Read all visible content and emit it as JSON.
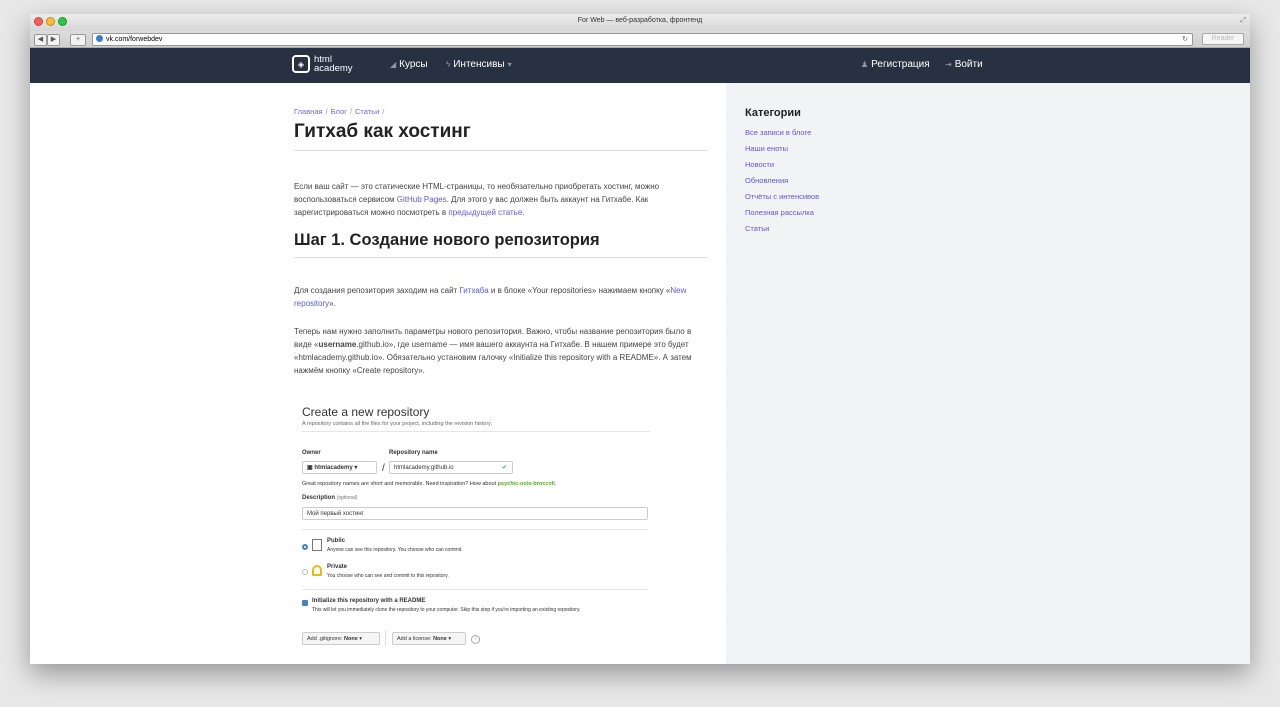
{
  "window": {
    "title": "For Web — веб-разработка, фронтенд",
    "url": "vk.com/forwebdev",
    "reader": "Reader"
  },
  "nav": {
    "logo_line1": "html",
    "logo_line2": "academy",
    "courses": "Курсы",
    "intensives": "Интенсивы",
    "register": "Регистрация",
    "login": "Войти"
  },
  "breadcrumbs": [
    "Главная",
    "Блог",
    "Статьи"
  ],
  "article": {
    "title": "Гитхаб как хостинг",
    "intro": {
      "t1": "Если ваш сайт — это статические HTML-страницы, то необязательно приобретать хостинг, можно воспользоваться сервисом ",
      "link1": "GitHub Pages",
      "t2": ". Для этого у вас должен быть аккаунт на Гитхабе. Как зарегистрироваться можно посмотреть в ",
      "link2": "предыдущей статье",
      "t3": "."
    },
    "step1_title": "Шаг 1. Создание нового репозитория",
    "p2": {
      "t1": "Для создания репозитория заходим на сайт ",
      "link1": "Гитхаба",
      "t2": " и в блоке «Your repositories» нажимаем кнопку «",
      "link2": "New repository",
      "t3": "»."
    },
    "p3": {
      "t1": "Теперь нам нужно заполнить параметры нового репозитория. Важно, чтобы название репозитория было в виде «",
      "bold": "username",
      "t2": ".github.io», где username — имя вашего аккаунта на Гитхабе. В нашем примере это будет «htmlacademy.github.io». Обязательно установим галочку «Initialize this repository with a README». А затем нажмём кнопку «Create repository»."
    }
  },
  "github": {
    "title": "Create a new repository",
    "subtitle": "A repository contains all the files for your project, including the revision history.",
    "owner_label": "Owner",
    "repo_label": "Repository name",
    "owner_value": "htmlacademy",
    "repo_value": "htmlacademy.github.io",
    "hint": "Great repository names are short and memorable. Need inspiration? How about ",
    "hint_name": "psychic-octo-broccoli",
    "desc_label": "Description",
    "desc_optional": "(optional)",
    "desc_value": "Мой первый хостинг",
    "public_label": "Public",
    "public_desc": "Anyone can see this repository. You choose who can commit.",
    "private_label": "Private",
    "private_desc": "You choose who can see and commit to this repository.",
    "readme_label": "Initialize this repository with a README",
    "readme_desc": "This will let you immediately clone the repository to your computer. Skip this step if you're importing an existing repository.",
    "gitignore": "Add .gitignore: ",
    "gitignore_val": "None",
    "license": "Add a license: ",
    "license_val": "None"
  },
  "sidebar": {
    "heading": "Категории",
    "links": [
      "Все записи в блоге",
      "Наши еноты",
      "Новости",
      "Обновления",
      "Отчёты с интенсивов",
      "Полезная рассылка",
      "Статьи"
    ]
  }
}
